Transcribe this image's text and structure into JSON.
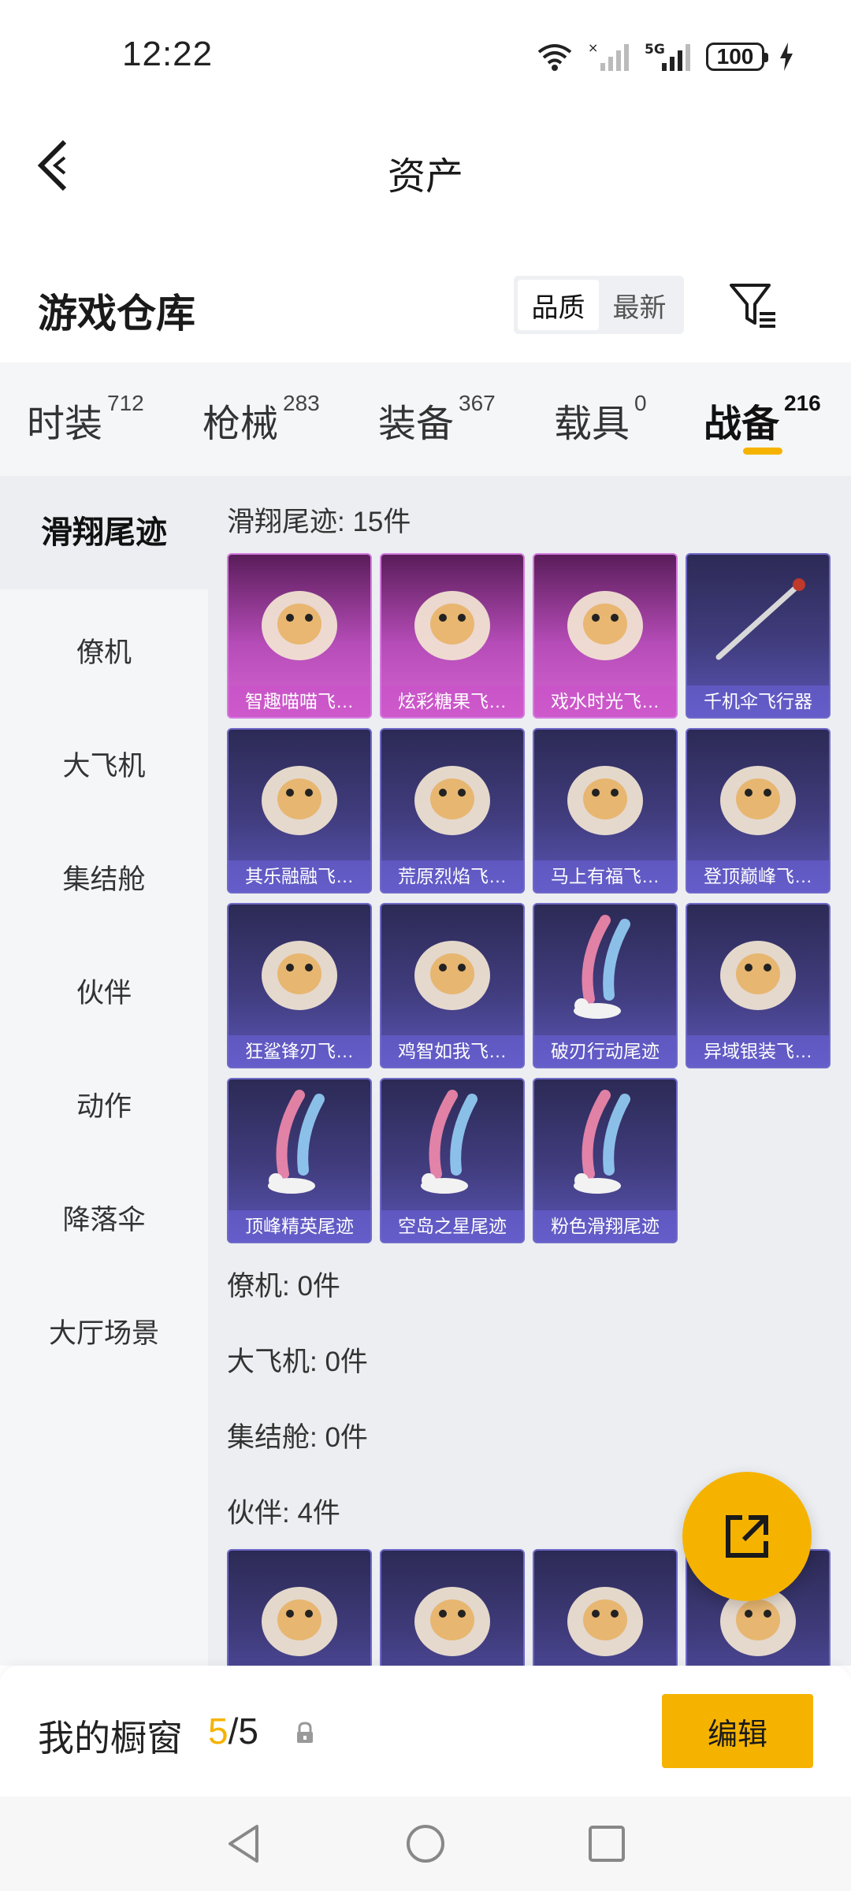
{
  "status_bar": {
    "time": "12:22",
    "network": "5G",
    "battery": "100"
  },
  "header": {
    "title": "资产"
  },
  "warehouse": {
    "title": "游戏仓库",
    "sort_options": [
      "品质",
      "最新"
    ],
    "sort_selected": "品质"
  },
  "category_tabs": [
    {
      "label": "时装",
      "count": "712"
    },
    {
      "label": "枪械",
      "count": "283"
    },
    {
      "label": "装备",
      "count": "367"
    },
    {
      "label": "载具",
      "count": "0"
    },
    {
      "label": "战备",
      "count": "216",
      "active": true
    }
  ],
  "sidebar": {
    "items": [
      "滑翔尾迹",
      "僚机",
      "大飞机",
      "集结舱",
      "伙伴",
      "动作",
      "降落伞",
      "大厅场景"
    ],
    "active": "滑翔尾迹"
  },
  "content": {
    "glide_section": "滑翔尾迹: 15件",
    "glide_items": [
      {
        "label": "智趣喵喵飞…",
        "rarity": "pink",
        "icon": "cat-hovercraft-icon"
      },
      {
        "label": "炫彩糖果飞…",
        "rarity": "pink",
        "icon": "candy-glider-icon"
      },
      {
        "label": "戏水时光飞…",
        "rarity": "pink",
        "icon": "giraffe-float-icon"
      },
      {
        "label": "千机伞飞行器",
        "rarity": "purple",
        "icon": "umbrella-rod-icon"
      },
      {
        "label": "其乐融融飞…",
        "rarity": "purple",
        "icon": "penguin-balloon-icon"
      },
      {
        "label": "荒原烈焰飞…",
        "rarity": "purple",
        "icon": "flame-glider-icon"
      },
      {
        "label": "马上有福飞…",
        "rarity": "purple",
        "icon": "horse-toy-icon"
      },
      {
        "label": "登顶巅峰飞…",
        "rarity": "purple",
        "icon": "jet-glider-icon"
      },
      {
        "label": "狂鲨锋刃飞…",
        "rarity": "purple",
        "icon": "shark-glider-icon"
      },
      {
        "label": "鸡智如我飞…",
        "rarity": "purple",
        "icon": "chicken-glider-icon"
      },
      {
        "label": "破刃行动尾迹",
        "rarity": "purple",
        "icon": "smoke-trail-icon"
      },
      {
        "label": "异域银装飞…",
        "rarity": "purple",
        "icon": "wing-glider-icon"
      },
      {
        "label": "顶峰精英尾迹",
        "rarity": "purple",
        "icon": "smoke-trail-icon"
      },
      {
        "label": "空岛之星尾迹",
        "rarity": "purple",
        "icon": "smoke-trail-icon"
      },
      {
        "label": "粉色滑翔尾迹",
        "rarity": "purple",
        "icon": "smoke-trail-icon"
      }
    ],
    "wingman_section": "僚机: 0件",
    "bigplane_section": "大飞机: 0件",
    "capsule_section": "集结舱: 0件",
    "partner_section": "伙伴: 4件",
    "partner_items": [
      {
        "icon": "chick-partner-icon"
      },
      {
        "icon": "rooster-partner-icon"
      },
      {
        "icon": "pink-bird-partner-icon"
      },
      {
        "icon": "helmet-chick-partner-icon"
      }
    ]
  },
  "bottom_bar": {
    "title": "我的橱窗",
    "count_current": "5",
    "count_total": "/5",
    "edit_label": "编辑"
  },
  "colors": {
    "accent": "#f5b300",
    "card_purple": "#413d7f",
    "card_pink": "#b64cb8"
  }
}
